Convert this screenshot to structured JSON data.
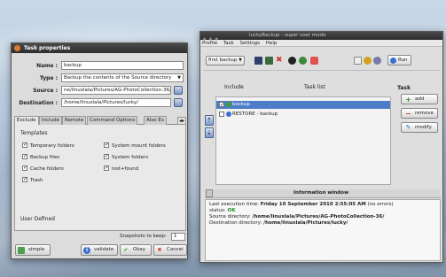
{
  "dialog": {
    "title": "Task properties",
    "name_label": "Name :",
    "name_value": "backup",
    "type_label": "Type :",
    "type_value": "Backup the contents of the Source directory",
    "source_label": "Source :",
    "source_value": "ne/linuxlala/Pictures/AG-PhotoCollection-36/",
    "destination_label": "Destination :",
    "destination_value": "/home/linuxlala/Pictures/lucky/",
    "tabs": [
      "Exclude",
      "Include",
      "Remote",
      "Command Options",
      "Also Ex"
    ],
    "templates_label": "Templates",
    "templates": [
      {
        "label": "Temporary folders",
        "checked": true
      },
      {
        "label": "System mount folders",
        "checked": true
      },
      {
        "label": "Backup files",
        "checked": true
      },
      {
        "label": "System folders",
        "checked": true
      },
      {
        "label": "Cache folders",
        "checked": true
      },
      {
        "label": "lost+found",
        "checked": true
      },
      {
        "label": "Trash",
        "checked": true
      }
    ],
    "user_defined_label": "User Defined",
    "snapshots_label": "Snapshots to keep:",
    "snapshots_value": "1",
    "buttons": {
      "simple": "simple",
      "validate": "validate",
      "okay": "Okay",
      "cancel": "Cancel"
    }
  },
  "main": {
    "title": "luckyBackup - super user mode",
    "menu": [
      "Profile",
      "Task",
      "Settings",
      "Help"
    ],
    "profile_value": "first backup",
    "run_label": "Run",
    "include_header": "Include",
    "task_list_header": "Task list",
    "tasks": [
      {
        "label": "backup",
        "checked": true,
        "selected": true
      },
      {
        "label": "RESTORE - backup",
        "checked": false,
        "selected": false
      }
    ],
    "task_side_title": "Task",
    "side_buttons": {
      "add": "add",
      "remove": "remove",
      "modify": "modify"
    },
    "info_title": "Information window",
    "info": {
      "last_execution_label": "Last execution time:",
      "last_execution_value": "Friday 10 September 2010 2:55:05 AM",
      "last_execution_suffix": "(no errors)",
      "status_label": "status:",
      "status_value": "OK",
      "source_label": "Source directory:",
      "source_value": "/home/linuxlala/Pictures/AG-PhotoCollection-36/",
      "destination_label": "Destination directory:",
      "destination_value": "/home/linuxlala/Pictures/lucky/"
    }
  },
  "colors": {
    "selection": "#4e7dc7",
    "ok": "#1a8a1a",
    "remove": "#d23a2a",
    "add": "#2e9a2e"
  }
}
